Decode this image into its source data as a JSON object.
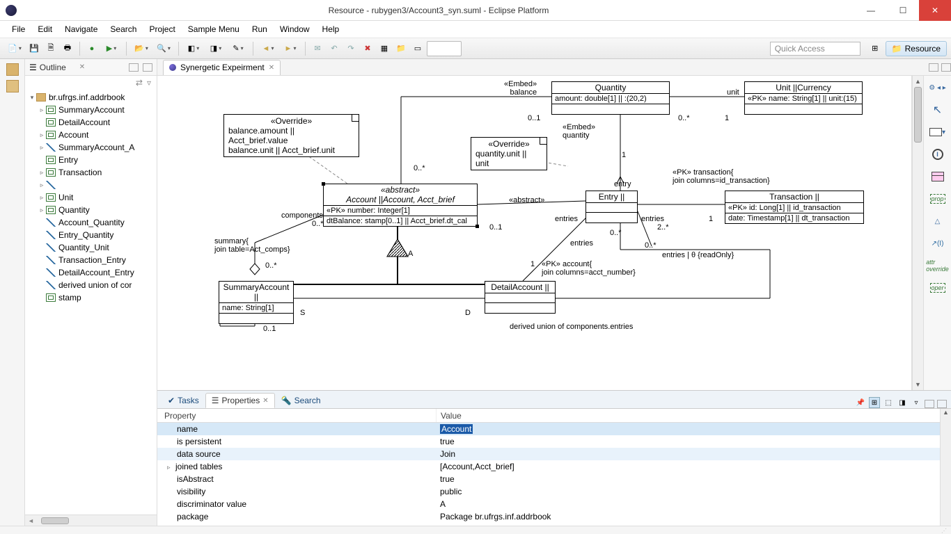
{
  "window": {
    "title": "Resource - rubygen3/Account3_syn.suml - Eclipse Platform"
  },
  "menu": [
    "File",
    "Edit",
    "Navigate",
    "Search",
    "Project",
    "Sample Menu",
    "Run",
    "Window",
    "Help"
  ],
  "quick_access_placeholder": "Quick Access",
  "perspective": {
    "label": "Resource"
  },
  "outline": {
    "title": "Outline",
    "root": "br.ufrgs.inf.addrbook",
    "items": [
      {
        "icon": "cls",
        "label": "SummaryAccount",
        "tw": "▹"
      },
      {
        "icon": "cls",
        "label": "DetailAccount",
        "tw": ""
      },
      {
        "icon": "cls",
        "label": "Account",
        "tw": "▹"
      },
      {
        "icon": "line",
        "label": "SummaryAccount_A",
        "tw": "▹"
      },
      {
        "icon": "cls",
        "label": "Entry",
        "tw": ""
      },
      {
        "icon": "cls",
        "label": "Transaction",
        "tw": "▹"
      },
      {
        "icon": "line",
        "label": "",
        "tw": "▹"
      },
      {
        "icon": "cls",
        "label": "Unit",
        "tw": "▹"
      },
      {
        "icon": "cls",
        "label": "Quantity",
        "tw": "▹"
      },
      {
        "icon": "line",
        "label": "Account_Quantity",
        "tw": ""
      },
      {
        "icon": "line",
        "label": "Entry_Quantity",
        "tw": ""
      },
      {
        "icon": "line",
        "label": "Quantity_Unit",
        "tw": ""
      },
      {
        "icon": "line",
        "label": "Transaction_Entry",
        "tw": ""
      },
      {
        "icon": "line",
        "label": "DetailAccount_Entry",
        "tw": ""
      },
      {
        "icon": "line",
        "label": "derived union of cor",
        "tw": ""
      },
      {
        "icon": "cls",
        "label": "stamp",
        "tw": ""
      }
    ]
  },
  "editor": {
    "tab": "Synergetic Expeirment"
  },
  "diagram": {
    "boxes": {
      "quantity": {
        "title": "Quantity",
        "attr": "amount: double[1] || :(20,2)"
      },
      "unit": {
        "title": "Unit ||Currency",
        "attr": "«PK» name: String[1] || unit:(15)"
      },
      "account": {
        "stereo": "«abstract»",
        "title": "Account ||Account, Acct_brief",
        "a1": "«PK» number: Integer[1]",
        "a2": "dtBalance: stamp[0..1] || Acct_brief.dt_cal"
      },
      "entry": {
        "title": "Entry ||"
      },
      "transaction": {
        "title": "Transaction ||",
        "a1": "«PK» id: Long[1] || id_transaction",
        "a2": "date: Timestamp[1] || dt_transaction"
      },
      "summary": {
        "title": "SummaryAccount ||",
        "a1": "name: String[1]"
      },
      "detail": {
        "title": "DetailAccount ||"
      }
    },
    "notes": {
      "n1": {
        "l1": "«Override»",
        "l2": "balance.amount || Acct_brief.value",
        "l3": "balance.unit || Acct_brief.unit"
      },
      "n2": {
        "l1": "«Override»",
        "l2": "quantity.unit || unit"
      }
    },
    "labels": {
      "embed_balance": "«Embed»\nbalance",
      "embed_quantity": "«Embed»\nquantity",
      "unit": "unit",
      "m01a": "0..1",
      "m01b": "0..*",
      "m1a": "1",
      "m1b": "1",
      "abstract": "«abstract»",
      "entries_l": "entries",
      "entries_r": "entries",
      "entries_b": "entries",
      "entry_t": "entry",
      "m0s_a": "0..*",
      "m0s_b": "0..*",
      "m0s_c": "0..*",
      "m0s_d": "0..*",
      "m0s_e": "0..1",
      "m2s": "2..*",
      "pk_trans": "«PK» transaction{\njoin columns=id_transaction}",
      "pk_acct": "«PK» account{\njoin columns=acct_number}",
      "entries_ro": "entries | θ {readOnly}",
      "derived": "derived union of components.entries",
      "components": "components",
      "m0s_comp": "0..*",
      "summary_join": "summary{\njoin table=Act_comps}",
      "m0s_sum": "0..*",
      "m01_sum": "0..1",
      "S": "S",
      "D": "D",
      "A": "A",
      "m1_acct": "1"
    }
  },
  "bottom": {
    "tabs": [
      "Tasks",
      "Properties",
      "Search"
    ],
    "active": 1,
    "headers": [
      "Property",
      "Value"
    ],
    "rows": [
      {
        "k": "name",
        "v": "Account",
        "sel": true,
        "vsel": true
      },
      {
        "k": "is persistent",
        "v": "true"
      },
      {
        "k": "data source",
        "v": "Join",
        "sel2": true
      },
      {
        "k": "joined tables",
        "v": "[Account,Acct_brief]",
        "tw": "▹"
      },
      {
        "k": "isAbstract",
        "v": "true"
      },
      {
        "k": "visibility",
        "v": "public"
      },
      {
        "k": "discriminator value",
        "v": "A"
      },
      {
        "k": "package",
        "v": "Package br.ufrgs.inf.addrbook"
      }
    ]
  }
}
